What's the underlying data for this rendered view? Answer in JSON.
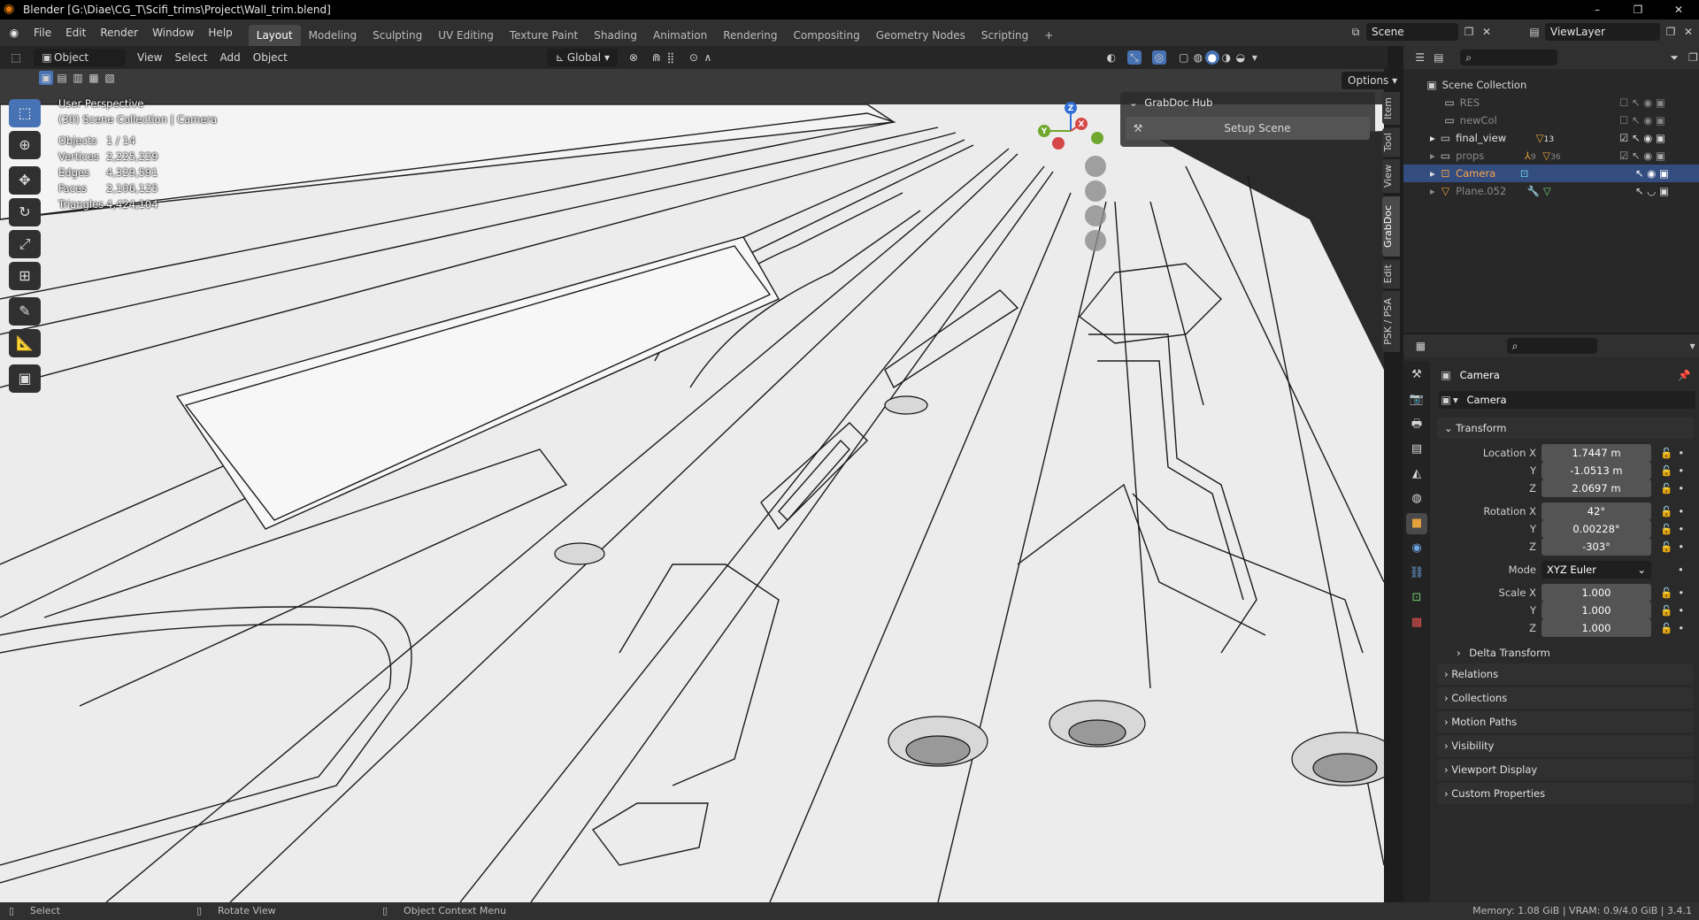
{
  "window": {
    "title": "Blender [G:\\Diae\\CG_T\\Scifi_trims\\Project\\Wall_trim.blend]",
    "controls": [
      "–",
      "❐",
      "✕"
    ]
  },
  "menus": [
    "File",
    "Edit",
    "Render",
    "Window",
    "Help"
  ],
  "workspaces": [
    "Layout",
    "Modeling",
    "Sculpting",
    "UV Editing",
    "Texture Paint",
    "Shading",
    "Animation",
    "Rendering",
    "Compositing",
    "Geometry Nodes",
    "Scripting"
  ],
  "active_workspace": "Layout",
  "scene": {
    "name": "Scene",
    "view_layer": "ViewLayer"
  },
  "header3d": {
    "mode": "Object Mode",
    "menus": [
      "View",
      "Select",
      "Add",
      "Object"
    ],
    "orientation": "Global",
    "options": "Options"
  },
  "viewport": {
    "perspective": "User Perspective",
    "collection": "(30) Scene Collection | Camera",
    "stats": [
      {
        "label": "Objects",
        "value": "1 / 14"
      },
      {
        "label": "Vertices",
        "value": "2,225,229"
      },
      {
        "label": "Edges",
        "value": "4,329,591"
      },
      {
        "label": "Faces",
        "value": "2,106,125"
      },
      {
        "label": "Triangles",
        "value": "4,424,104"
      }
    ],
    "gizmo": {
      "z": "Z",
      "x": "X",
      "y": "Y"
    }
  },
  "npanel": {
    "title": "GrabDoc Hub",
    "button": "Setup Scene",
    "tabs": [
      "Item",
      "Tool",
      "View",
      "GrabDoc",
      "Edit",
      "PSK / PSA"
    ],
    "active_tab": "GrabDoc"
  },
  "outliner": {
    "root": "Scene Collection",
    "items": [
      {
        "name": "RES",
        "badge": ""
      },
      {
        "name": "newCol",
        "badge": ""
      },
      {
        "name": "final_view",
        "badge": "13"
      },
      {
        "name": "props",
        "badge": "36"
      },
      {
        "name": "Camera",
        "badge": ""
      },
      {
        "name": "Plane.052",
        "badge": ""
      }
    ],
    "props_sub_badge": "9"
  },
  "properties": {
    "object_name": "Camera",
    "data_name": "Camera",
    "transform_header": "Transform",
    "location_label": "Location X",
    "rotation_label": "Rotation X",
    "scale_label": "Scale X",
    "y_label": "Y",
    "z_label": "Z",
    "mode_label": "Mode",
    "location": [
      "1.7447 m",
      "-1.0513 m",
      "2.0697 m"
    ],
    "rotation": [
      "42°",
      "0.00228°",
      "-303°"
    ],
    "mode": "XYZ Euler",
    "scale": [
      "1.000",
      "1.000",
      "1.000"
    ],
    "delta_transform": "Delta Transform",
    "sections": [
      "Relations",
      "Collections",
      "Motion Paths",
      "Visibility",
      "Viewport Display",
      "Custom Properties"
    ]
  },
  "statusbar": {
    "left": [
      "Select",
      "Rotate View",
      "Object Context Menu"
    ],
    "right": "Memory: 1.08 GiB | VRAM: 0.9/4.0 GiB | 3.4.1"
  }
}
